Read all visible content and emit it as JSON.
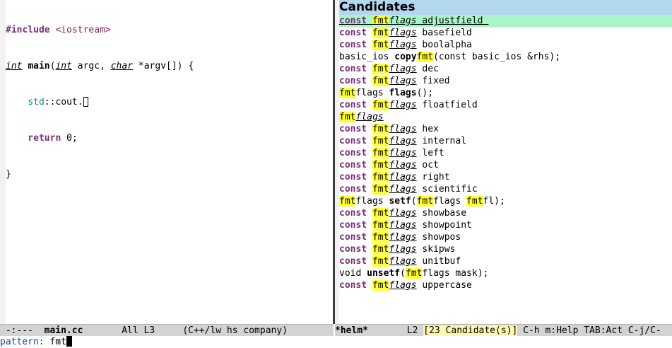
{
  "editor": {
    "lines": [
      {
        "directive": "#include",
        "header": "<iostream>"
      },
      {
        "t1": "int",
        "fname": "main",
        "p1": "(",
        "t2": "int",
        "p2": " argc, ",
        "t3": "char",
        "p3": " *argv[]) {"
      },
      {
        "ns": "std",
        "sep": "::",
        "ident": "cout."
      },
      {
        "keyword": "return",
        "value": " 0;"
      },
      {
        "brace": "}"
      }
    ]
  },
  "helm": {
    "header_title": "Candidates",
    "candidates": [
      {
        "c": "const",
        "s1": " ",
        "h": "fmt",
        "t": "flags",
        "r": " adjustfield "
      },
      {
        "c": "const",
        "s1": " ",
        "h": "fmt",
        "t": "flags",
        "r": " basefield"
      },
      {
        "c": "const",
        "s1": " ",
        "h": "fmt",
        "t": "flags",
        "r": " boolalpha"
      },
      {
        "pre": "basic_ios ",
        "fn": "copy",
        "h": "fmt",
        "post": "(const basic_ios &rhs);"
      },
      {
        "c": "const",
        "s1": " ",
        "h": "fmt",
        "t": "flags",
        "r": " dec"
      },
      {
        "c": "const",
        "s1": " ",
        "h": "fmt",
        "t": "flags",
        "r": " fixed"
      },
      {
        "h": "fmt",
        "mid": "flags ",
        "fn": "flags",
        "post": "();"
      },
      {
        "c": "const",
        "s1": " ",
        "h": "fmt",
        "t": "flags",
        "r": " floatfield"
      },
      {
        "h": "fmt",
        "t": "flags"
      },
      {
        "c": "const",
        "s1": " ",
        "h": "fmt",
        "t": "flags",
        "r": " hex"
      },
      {
        "c": "const",
        "s1": " ",
        "h": "fmt",
        "t": "flags",
        "r": " internal"
      },
      {
        "c": "const",
        "s1": " ",
        "h": "fmt",
        "t": "flags",
        "r": " left"
      },
      {
        "c": "const",
        "s1": " ",
        "h": "fmt",
        "t": "flags",
        "r": " oct"
      },
      {
        "c": "const",
        "s1": " ",
        "h": "fmt",
        "t": "flags",
        "r": " right"
      },
      {
        "c": "const",
        "s1": " ",
        "h": "fmt",
        "t": "flags",
        "r": " scientific"
      },
      {
        "h": "fmt",
        "mid": "flags ",
        "fn": "setf",
        "p": "(",
        "h2": "fmt",
        "mid2": "flags ",
        "h3": "fmt",
        "post": "fl);"
      },
      {
        "c": "const",
        "s1": " ",
        "h": "fmt",
        "t": "flags",
        "r": " showbase"
      },
      {
        "c": "const",
        "s1": " ",
        "h": "fmt",
        "t": "flags",
        "r": " showpoint"
      },
      {
        "c": "const",
        "s1": " ",
        "h": "fmt",
        "t": "flags",
        "r": " showpos"
      },
      {
        "c": "const",
        "s1": " ",
        "h": "fmt",
        "t": "flags",
        "r": " skipws"
      },
      {
        "c": "const",
        "s1": " ",
        "h": "fmt",
        "t": "flags",
        "r": " unitbuf"
      },
      {
        "pre": "void ",
        "fn": "unsetf",
        "p": "(",
        "h": "fmt",
        "post": "flags mask);"
      },
      {
        "c": "const",
        "s1": " ",
        "h": "fmt",
        "t": "flags",
        "r": " uppercase"
      }
    ]
  },
  "modeline_left": {
    "state": " -:---  ",
    "buffer": "main.cc",
    "position": "       All L3     ",
    "modes": "(C++/lw hs company)"
  },
  "modeline_right": {
    "buffer": "*helm*",
    "line": "       L2 ",
    "count": "[23 Candidate(s)]",
    "help": " C-h m:Help TAB:Act C-j/C-"
  },
  "minibuffer": {
    "prompt": "pattern: ",
    "value": "fmt"
  }
}
